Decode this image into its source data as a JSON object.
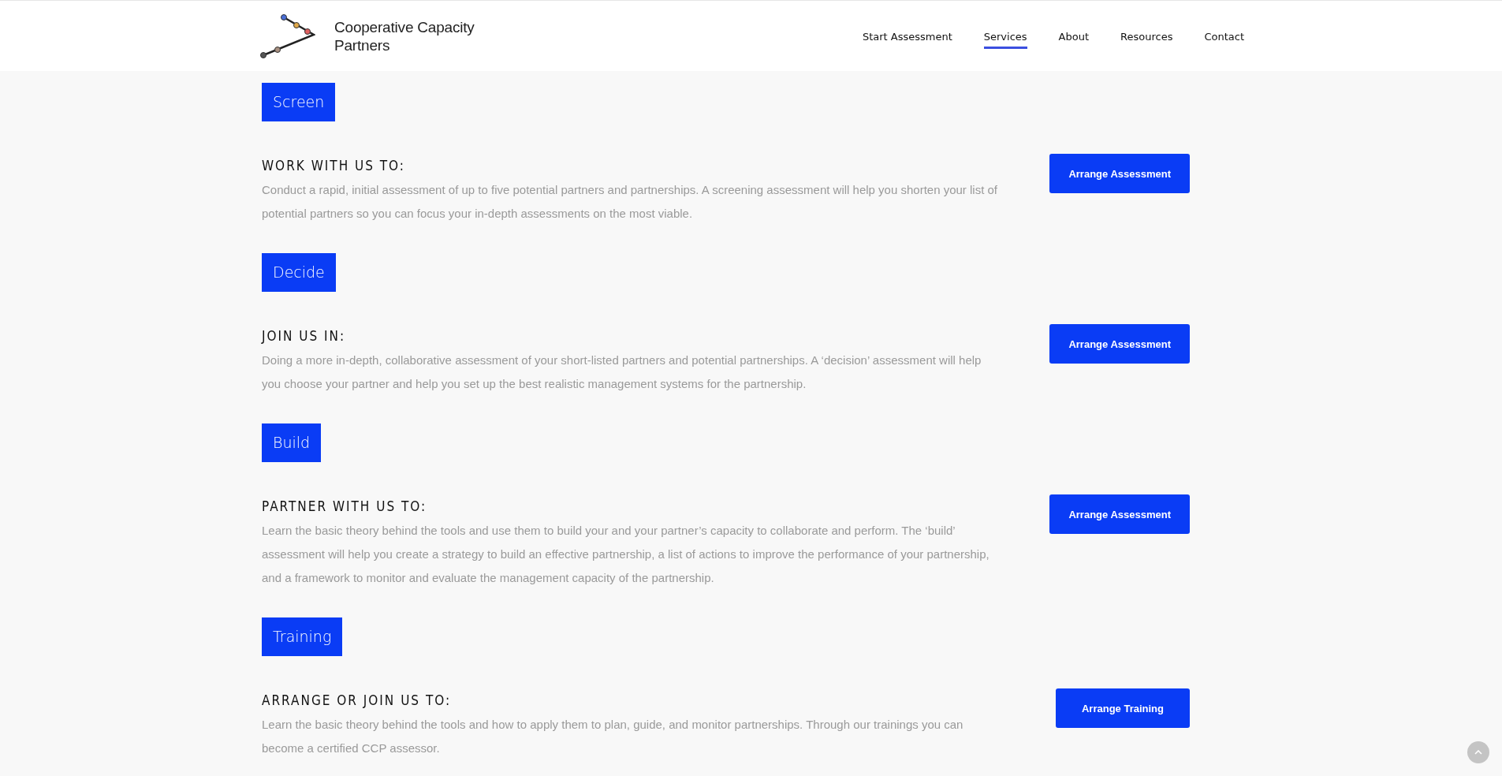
{
  "header": {
    "logo_text": "Cooperative Capacity Partners",
    "nav": [
      {
        "label": "Start Assessment",
        "selected": false
      },
      {
        "label": "Services",
        "selected": true
      },
      {
        "label": "About",
        "selected": false
      },
      {
        "label": "Resources",
        "selected": false
      },
      {
        "label": "Contact",
        "selected": false
      }
    ]
  },
  "services": [
    {
      "tag": "Screen",
      "heading": "WORK WITH US TO:",
      "text": "Conduct a rapid, initial assessment of up to five potential partners and partnerships. A screening assessment will help you shorten your list of potential partners so you can focus your in-depth assessments on the most viable.",
      "button": "Arrange Assessment"
    },
    {
      "tag": "Decide",
      "heading": "JOIN US IN:",
      "text": "Doing a more  in-depth, collaborative assessment of your short-listed partners and potential partnerships. A ‘decision’ assessment will help you choose your partner and help you set up the best realistic management systems for the partnership.",
      "button": "Arrange Assessment"
    },
    {
      "tag": "Build",
      "heading": "PARTNER WITH US TO:",
      "text": "Learn the basic theory behind the tools and use them to build your and your partner’s capacity to collaborate and perform. The ‘build’ assessment will help you create a strategy to build an effective partnership, a list of actions to improve the performance of your partnership, and a framework to monitor and evaluate the management capacity of the partnership.",
      "button": "Arrange Assessment"
    },
    {
      "tag": "Training",
      "heading": "ARRANGE OR JOIN US TO:",
      "text": "Learn the basic theory behind the tools and how to apply them to plan, guide, and monitor partnerships. Through our trainings you can become a certified CCP assessor.",
      "button": "Arrange Training"
    }
  ]
}
